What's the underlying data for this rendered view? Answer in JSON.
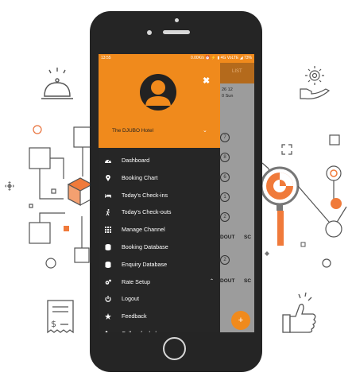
{
  "status_bar": {
    "time": "13:55",
    "indicators": "0.00K/s ⏰ ⚡ ▮ 4G VoLTE ◢ 73%"
  },
  "drawer": {
    "close_icon": "close-icon",
    "hotel_name": "The DJUBO Hotel",
    "menu": [
      {
        "label": "Dashboard",
        "icon": "dashboard-icon"
      },
      {
        "label": "Booking Chart",
        "icon": "map-marker-icon"
      },
      {
        "label": "Today's Check-ins",
        "icon": "bed-icon"
      },
      {
        "label": "Today's Check-outs",
        "icon": "walking-icon"
      },
      {
        "label": "Manage Channel",
        "icon": "grid-icon"
      },
      {
        "label": "Booking Database",
        "icon": "database-icon"
      },
      {
        "label": "Enquiry Database",
        "icon": "database-icon"
      },
      {
        "label": "Rate Setup",
        "icon": "gears-icon",
        "expanded": true
      },
      {
        "label": "Logout",
        "icon": "power-icon"
      },
      {
        "label": "Feedback",
        "icon": "star-icon"
      },
      {
        "label": "Call us for help",
        "icon": "phone-icon"
      }
    ]
  },
  "background_app": {
    "list_tab": "LIST",
    "date_row1": "26  12",
    "date_row2": "0  Sun",
    "circles": [
      "7",
      "8",
      "6",
      "1",
      "2",
      "2"
    ],
    "labels": [
      "DOUT",
      "SC",
      "DOUT",
      "SC"
    ],
    "fab": "+"
  },
  "colors": {
    "accent": "#f08a1c",
    "drawer_bg": "#262626",
    "phone_body": "#252525"
  }
}
